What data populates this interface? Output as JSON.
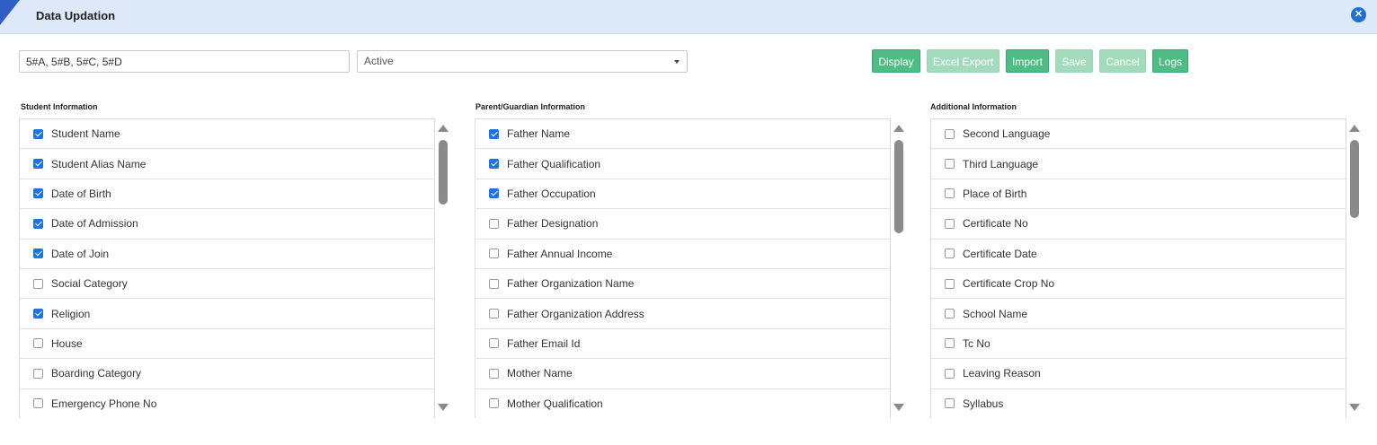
{
  "header": {
    "title": "Data Updation"
  },
  "filters": {
    "sections_value": "5#A, 5#B, 5#C, 5#D",
    "status_value": "Active"
  },
  "toolbar": {
    "display": "Display",
    "excel_export": "Excel Export",
    "import": "Import",
    "save": "Save",
    "cancel": "Cancel",
    "logs": "Logs"
  },
  "panels": [
    {
      "title": "Student Information",
      "items": [
        {
          "label": "Student Name",
          "checked": true
        },
        {
          "label": "Student Alias Name",
          "checked": true
        },
        {
          "label": "Date of Birth",
          "checked": true
        },
        {
          "label": "Date of Admission",
          "checked": true
        },
        {
          "label": "Date of Join",
          "checked": true
        },
        {
          "label": "Social Category",
          "checked": false
        },
        {
          "label": "Religion",
          "checked": true
        },
        {
          "label": "House",
          "checked": false
        },
        {
          "label": "Boarding Category",
          "checked": false
        },
        {
          "label": "Emergency Phone No",
          "checked": false
        }
      ]
    },
    {
      "title": "Parent/Guardian Information",
      "items": [
        {
          "label": "Father Name",
          "checked": true
        },
        {
          "label": "Father Qualification",
          "checked": true
        },
        {
          "label": "Father Occupation",
          "checked": true
        },
        {
          "label": "Father Designation",
          "checked": false
        },
        {
          "label": "Father Annual Income",
          "checked": false
        },
        {
          "label": "Father Organization Name",
          "checked": false
        },
        {
          "label": "Father Organization Address",
          "checked": false
        },
        {
          "label": "Father Email Id",
          "checked": false
        },
        {
          "label": "Mother Name",
          "checked": false
        },
        {
          "label": "Mother Qualification",
          "checked": false
        }
      ]
    },
    {
      "title": "Additional Information",
      "items": [
        {
          "label": "Second Language",
          "checked": false
        },
        {
          "label": "Third Language",
          "checked": false
        },
        {
          "label": "Place of Birth",
          "checked": false
        },
        {
          "label": "Certificate No",
          "checked": false
        },
        {
          "label": "Certificate Date",
          "checked": false
        },
        {
          "label": "Certificate Crop No",
          "checked": false
        },
        {
          "label": "School Name",
          "checked": false
        },
        {
          "label": "Tc No",
          "checked": false
        },
        {
          "label": "Leaving Reason",
          "checked": false
        },
        {
          "label": "Syllabus",
          "checked": false
        }
      ]
    }
  ],
  "colors": {
    "header_bg": "#dde8f8",
    "accent_blue": "#2f5fc4",
    "button_green": "#4dbd84",
    "button_green_disabled": "#a3dcbd",
    "checkbox_blue": "#1a73e8"
  }
}
